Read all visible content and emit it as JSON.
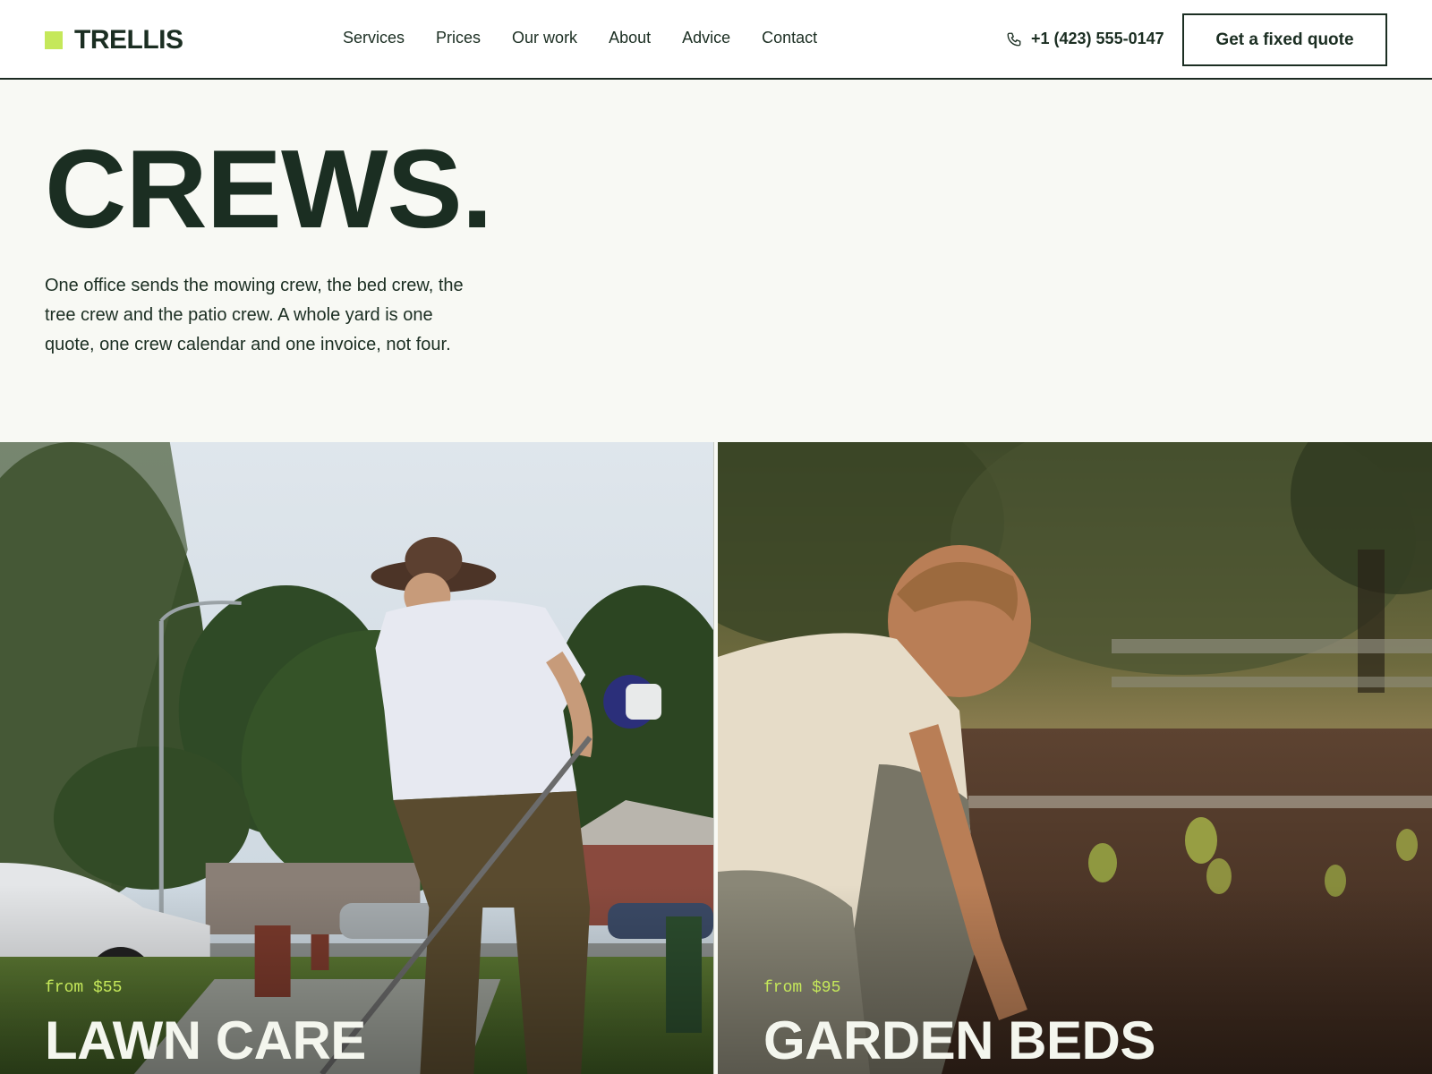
{
  "brand": {
    "name": "TRELLIS",
    "accent": "#c5e85a",
    "ink": "#1b2e22"
  },
  "nav": {
    "items": [
      {
        "label": "Services"
      },
      {
        "label": "Prices"
      },
      {
        "label": "Our work"
      },
      {
        "label": "About"
      },
      {
        "label": "Advice"
      },
      {
        "label": "Contact"
      }
    ]
  },
  "header": {
    "phone": "+1 (423) 555-0147",
    "phone_icon": "phone-icon",
    "cta_label": "Get a fixed quote"
  },
  "hero": {
    "title": "CREWS.",
    "description": "One office sends the mowing crew, the bed crew, the tree crew and the patio crew. A whole yard is one quote, one crew calendar and one invoice, not four."
  },
  "cards": [
    {
      "price": "from $55",
      "title": "LAWN CARE"
    },
    {
      "price": "from $95",
      "title": "GARDEN BEDS"
    }
  ]
}
